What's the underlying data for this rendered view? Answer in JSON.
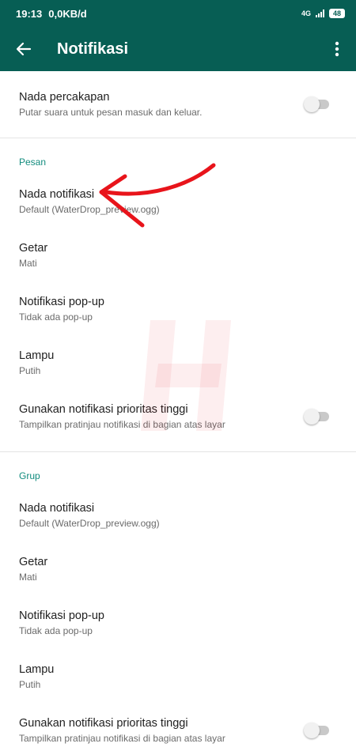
{
  "status_bar": {
    "time": "19:13",
    "speed": "0,0KB/d",
    "network": "4G",
    "battery": "48"
  },
  "toolbar": {
    "title": "Notifikasi"
  },
  "conversation": {
    "title": "Nada percakapan",
    "subtitle": "Putar suara untuk pesan masuk dan keluar.",
    "toggle_on": false
  },
  "pesan": {
    "header": "Pesan",
    "items": [
      {
        "title": "Nada notifikasi",
        "subtitle": "Default (WaterDrop_preview.ogg)"
      },
      {
        "title": "Getar",
        "subtitle": "Mati"
      },
      {
        "title": "Notifikasi pop-up",
        "subtitle": "Tidak ada pop-up"
      },
      {
        "title": "Lampu",
        "subtitle": "Putih"
      },
      {
        "title": "Gunakan notifikasi prioritas tinggi",
        "subtitle": "Tampilkan pratinjau notifikasi di bagian atas layar",
        "toggle_on": false
      }
    ]
  },
  "grup": {
    "header": "Grup",
    "items": [
      {
        "title": "Nada notifikasi",
        "subtitle": "Default (WaterDrop_preview.ogg)"
      },
      {
        "title": "Getar",
        "subtitle": "Mati"
      },
      {
        "title": "Notifikasi pop-up",
        "subtitle": "Tidak ada pop-up"
      },
      {
        "title": "Lampu",
        "subtitle": "Putih"
      },
      {
        "title": "Gunakan notifikasi prioritas tinggi",
        "subtitle": "Tampilkan pratinjau notifikasi di bagian atas layar",
        "toggle_on": false
      }
    ]
  },
  "colors": {
    "toolbar": "#075e54",
    "section_header": "#128c7e",
    "annotation_arrow": "#e8141b"
  }
}
